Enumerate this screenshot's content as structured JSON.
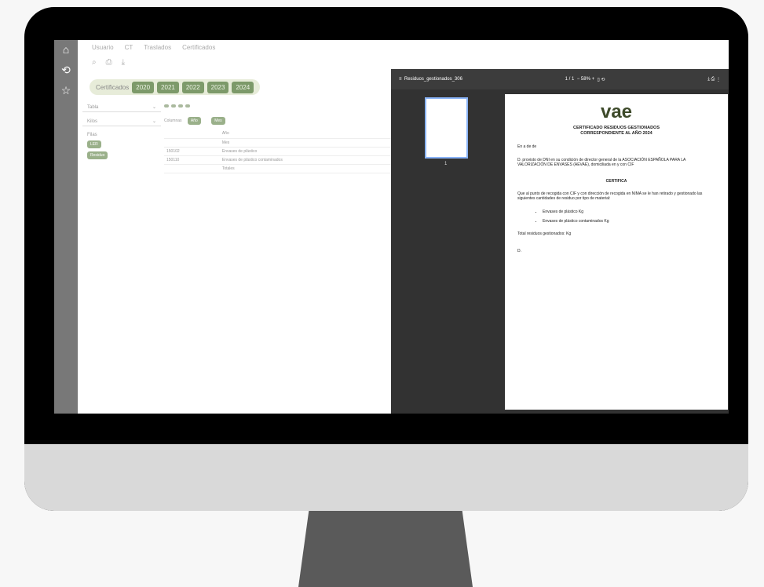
{
  "rail_icons": [
    "home-icon",
    "history-icon",
    "star-icon"
  ],
  "topbar": {
    "usuario": "Usuario",
    "ct": "CT",
    "traslados": "Traslados",
    "certificados": "Certificados"
  },
  "years": {
    "label": "Certificados",
    "items": [
      "2020",
      "2021",
      "2022",
      "2023",
      "2024"
    ]
  },
  "left": {
    "tabla": "Tabla",
    "kilos": "Kilos",
    "filas": "Filas",
    "ler": "LER",
    "residuo": "Residuo"
  },
  "grid": {
    "columnas": "Columnas",
    "ano": "Año",
    "mes": "Mes",
    "row1": "Envases de plástico",
    "row2": "Envases de plástico contaminados",
    "totales": "Totales",
    "code1": "150102",
    "code2": "150110"
  },
  "pdf": {
    "filename": "Residuos_gestionados_306",
    "page": "1 / 1",
    "zoom": "58%",
    "thumb_no": "1",
    "logo": "vae",
    "title1": "CERTIFICADO RESIDUOS GESTIONADOS",
    "title2": "CORRESPONDIENTE AL AÑO 2024",
    "line_en": "En      a  de   de",
    "para1": "D.                              provisto de DNI               en su condición de director general de la ASOCIACIÓN ESPAÑOLA PARA LA VALORIZACIÓN DE ENVASES (AEVAE), domiciliada en y con CIF",
    "certifica": "CERTIFICA",
    "para2": "Que al punto de recogida                                            con CIF          y con dirección de recogida en          NIMA          se le han retirado y gestionado las siguientes cantidades de residuo por tipo de material:",
    "b1": "Envases de plástico                 Kg",
    "b2": "Envases de plástico contaminados    Kg",
    "total": "Total residuos gestionados:      Kg",
    "sign": "D."
  }
}
